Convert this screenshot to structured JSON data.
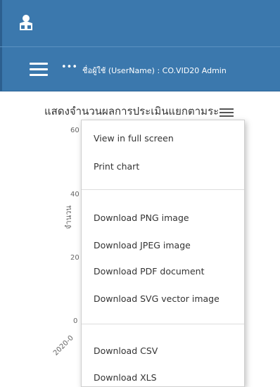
{
  "header": {
    "username_label": "ชื่อผู้ใช้ (UserName) : CO.VID20 Admin",
    "more_label": "•••",
    "app_icon": "user-home-icon",
    "menu_icon": "hamburger-icon"
  },
  "chart": {
    "title": "แสดงจำนวนผลการประเมินแยกตามระ",
    "ylabel": "จำนวน",
    "yticks": [
      "60",
      "40",
      "20",
      "0"
    ],
    "xtick_partial": "2020-0"
  },
  "context_menu": {
    "items": [
      "View in full screen",
      "Print chart",
      "Download PNG image",
      "Download JPEG image",
      "Download PDF document",
      "Download SVG vector image",
      "Download CSV",
      "Download XLS"
    ]
  },
  "colors": {
    "header": "#3b78ad",
    "text": "#333333"
  }
}
